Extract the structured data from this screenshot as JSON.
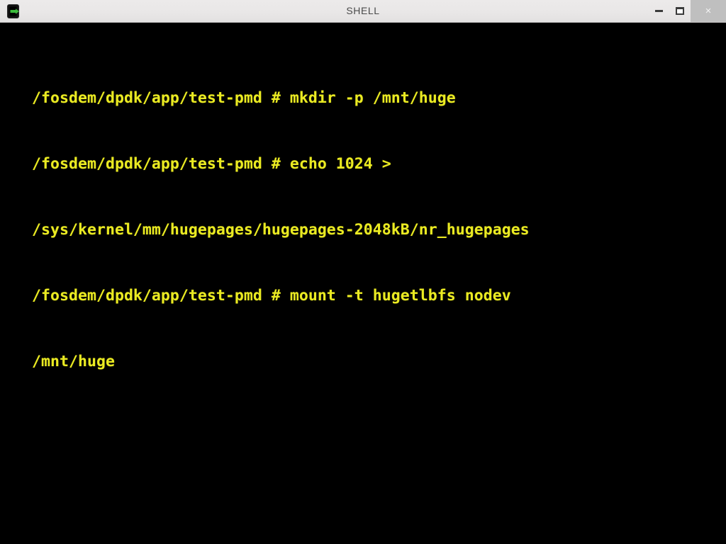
{
  "window": {
    "title": "SHELL",
    "icon": "terminal-icon",
    "controls": {
      "minimize_label": "",
      "maximize_label": "",
      "close_label": "×"
    }
  },
  "colors": {
    "titlebar_bg": "#eceaea",
    "titlebar_text": "#4a4a4a",
    "close_button_bg": "#bfbfbf",
    "terminal_bg": "#000000",
    "terminal_text": "#eaea22",
    "icon_accent": "#3dbb3d"
  },
  "terminal": {
    "prompt": "/fosdem/dpdk/app/test-pmd # ",
    "lines": [
      "/fosdem/dpdk/app/test-pmd # mkdir -p /mnt/huge",
      "/fosdem/dpdk/app/test-pmd # echo 1024 >",
      "/sys/kernel/mm/hugepages/hugepages-2048kB/nr_hugepages",
      "/fosdem/dpdk/app/test-pmd # mount -t hugetlbfs nodev",
      "/mnt/huge"
    ],
    "commands": [
      "mkdir -p /mnt/huge",
      "echo 1024 > /sys/kernel/mm/hugepages/hugepages-2048kB/nr_hugepages",
      "mount -t hugetlbfs nodev /mnt/huge"
    ]
  }
}
